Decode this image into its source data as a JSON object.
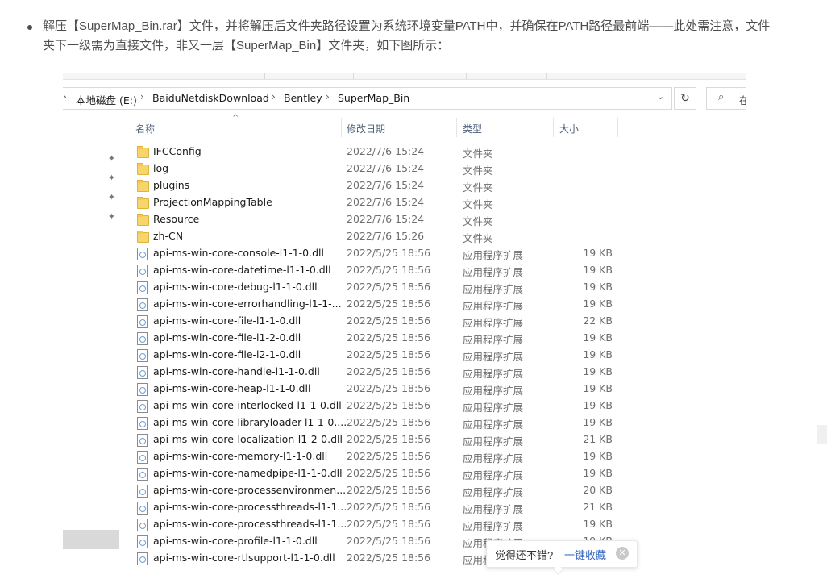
{
  "article": {
    "paragraph": "解压【SuperMap_Bin.rar】文件，并将解压后文件夹路径设置为系统环境变量PATH中，并确保在PATH路径最前端——此处需注意，文件夹下一级需为直接文件，非又一层【SuperMap_Bin】文件夹，如下图所示："
  },
  "explorer": {
    "breadcrumb": [
      "本地磁盘 (E:)",
      "BaiduNetdiskDownload",
      "Bentley",
      "SuperMap_Bin"
    ],
    "search_placeholder": "在",
    "columns": {
      "name": "名称",
      "date": "修改日期",
      "type": "类型",
      "size": "大小"
    },
    "files": [
      {
        "name": "IFCConfig",
        "date": "2022/7/6 15:24",
        "type": "文件夹",
        "size": "",
        "icon": "folder-icon"
      },
      {
        "name": "log",
        "date": "2022/7/6 15:24",
        "type": "文件夹",
        "size": "",
        "icon": "folder-icon"
      },
      {
        "name": "plugins",
        "date": "2022/7/6 15:24",
        "type": "文件夹",
        "size": "",
        "icon": "folder-icon"
      },
      {
        "name": "ProjectionMappingTable",
        "date": "2022/7/6 15:24",
        "type": "文件夹",
        "size": "",
        "icon": "folder-icon"
      },
      {
        "name": "Resource",
        "date": "2022/7/6 15:24",
        "type": "文件夹",
        "size": "",
        "icon": "folder-icon"
      },
      {
        "name": "zh-CN",
        "date": "2022/7/6 15:26",
        "type": "文件夹",
        "size": "",
        "icon": "folder-icon"
      },
      {
        "name": "api-ms-win-core-console-l1-1-0.dll",
        "date": "2022/5/25 18:56",
        "type": "应用程序扩展",
        "size": "19 KB",
        "icon": "dll-icon"
      },
      {
        "name": "api-ms-win-core-datetime-l1-1-0.dll",
        "date": "2022/5/25 18:56",
        "type": "应用程序扩展",
        "size": "19 KB",
        "icon": "dll-icon"
      },
      {
        "name": "api-ms-win-core-debug-l1-1-0.dll",
        "date": "2022/5/25 18:56",
        "type": "应用程序扩展",
        "size": "19 KB",
        "icon": "dll-icon"
      },
      {
        "name": "api-ms-win-core-errorhandling-l1-1-...",
        "date": "2022/5/25 18:56",
        "type": "应用程序扩展",
        "size": "19 KB",
        "icon": "dll-icon"
      },
      {
        "name": "api-ms-win-core-file-l1-1-0.dll",
        "date": "2022/5/25 18:56",
        "type": "应用程序扩展",
        "size": "22 KB",
        "icon": "dll-icon"
      },
      {
        "name": "api-ms-win-core-file-l1-2-0.dll",
        "date": "2022/5/25 18:56",
        "type": "应用程序扩展",
        "size": "19 KB",
        "icon": "dll-icon"
      },
      {
        "name": "api-ms-win-core-file-l2-1-0.dll",
        "date": "2022/5/25 18:56",
        "type": "应用程序扩展",
        "size": "19 KB",
        "icon": "dll-icon"
      },
      {
        "name": "api-ms-win-core-handle-l1-1-0.dll",
        "date": "2022/5/25 18:56",
        "type": "应用程序扩展",
        "size": "19 KB",
        "icon": "dll-icon"
      },
      {
        "name": "api-ms-win-core-heap-l1-1-0.dll",
        "date": "2022/5/25 18:56",
        "type": "应用程序扩展",
        "size": "19 KB",
        "icon": "dll-icon"
      },
      {
        "name": "api-ms-win-core-interlocked-l1-1-0.dll",
        "date": "2022/5/25 18:56",
        "type": "应用程序扩展",
        "size": "19 KB",
        "icon": "dll-icon"
      },
      {
        "name": "api-ms-win-core-libraryloader-l1-1-0....",
        "date": "2022/5/25 18:56",
        "type": "应用程序扩展",
        "size": "19 KB",
        "icon": "dll-icon"
      },
      {
        "name": "api-ms-win-core-localization-l1-2-0.dll",
        "date": "2022/5/25 18:56",
        "type": "应用程序扩展",
        "size": "21 KB",
        "icon": "dll-icon"
      },
      {
        "name": "api-ms-win-core-memory-l1-1-0.dll",
        "date": "2022/5/25 18:56",
        "type": "应用程序扩展",
        "size": "19 KB",
        "icon": "dll-icon"
      },
      {
        "name": "api-ms-win-core-namedpipe-l1-1-0.dll",
        "date": "2022/5/25 18:56",
        "type": "应用程序扩展",
        "size": "19 KB",
        "icon": "dll-icon"
      },
      {
        "name": "api-ms-win-core-processenvironmen...",
        "date": "2022/5/25 18:56",
        "type": "应用程序扩展",
        "size": "20 KB",
        "icon": "dll-icon"
      },
      {
        "name": "api-ms-win-core-processthreads-l1-1...",
        "date": "2022/5/25 18:56",
        "type": "应用程序扩展",
        "size": "21 KB",
        "icon": "dll-icon"
      },
      {
        "name": "api-ms-win-core-processthreads-l1-1...",
        "date": "2022/5/25 18:56",
        "type": "应用程序扩展",
        "size": "19 KB",
        "icon": "dll-icon"
      },
      {
        "name": "api-ms-win-core-profile-l1-1-0.dll",
        "date": "2022/5/25 18:56",
        "type": "应用程序扩展",
        "size": "19 KB",
        "icon": "dll-icon"
      },
      {
        "name": "api-ms-win-core-rtlsupport-l1-1-0.dll",
        "date": "2022/5/25 18:56",
        "type": "应用程序扩展",
        "size": "",
        "icon": "dll-icon"
      }
    ]
  },
  "toast": {
    "question": "觉得还不错?",
    "action": "一键收藏"
  },
  "colors": {
    "link": "#3469c1",
    "folder": "#f8d56a",
    "header_text": "#4c607a"
  }
}
